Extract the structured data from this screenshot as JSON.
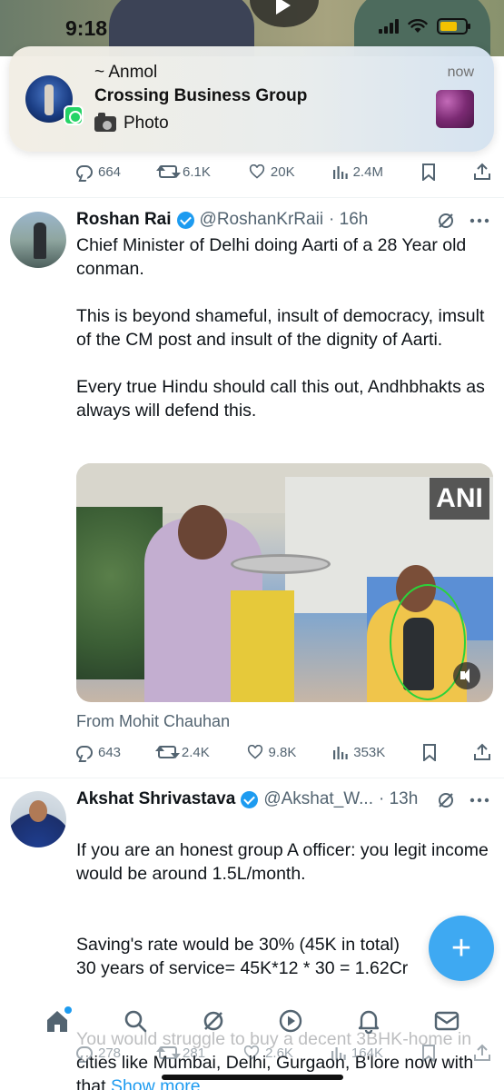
{
  "status_bar": {
    "time": "9:18"
  },
  "notification": {
    "sender": "~ Anmol",
    "group": "Crossing Business Group",
    "message": "Photo",
    "time": "now",
    "app_icon": "whatsapp-icon"
  },
  "prev_tweet_actions": {
    "replies": "664",
    "reposts": "6.1K",
    "likes": "20K",
    "views": "2.4M"
  },
  "tweets": [
    {
      "name": "Roshan Rai",
      "handle": "@RoshanKrRaii",
      "time": "· 16h",
      "paragraphs": [
        "Chief Minister of Delhi doing Aarti of a 28 Year old conman.",
        "This is beyond shameful, insult of democracy, imsult of the CM post and insult of the dignity of Aarti.",
        "Every true Hindu should call this out, Andhbhakts as always will defend this."
      ],
      "media_watermark": "ANI",
      "from": "From Mohit Chauhan",
      "replies": "643",
      "reposts": "2.4K",
      "likes": "9.8K",
      "views": "353K"
    },
    {
      "name": "Akshat Shrivastava",
      "handle": "@Akshat_W...",
      "time": "· 13h",
      "paragraphs": [
        "If you are an honest group A officer: you legit income would be around 1.5L/month.",
        "Saving's rate would be 30% (45K in total)\n30 years of service= 45K*12 * 30 = 1.62Cr",
        "You would struggle to buy a decent 3BHK-home in cities like Mumbai, Delhi, Gurgaon, B'lore now with that"
      ],
      "show_more": "Show more",
      "replies": "278",
      "reposts": "281",
      "likes": "2.6K",
      "views": "164K"
    }
  ],
  "fab": {
    "label": "+"
  },
  "nav": [
    "home-icon",
    "search-icon",
    "grok-icon",
    "video-icon",
    "notifications-icon",
    "messages-icon"
  ],
  "colors": {
    "accent": "#1d9bf0",
    "muted": "#536471",
    "text": "#0f1419",
    "circle_annotation": "#2cd23a"
  }
}
